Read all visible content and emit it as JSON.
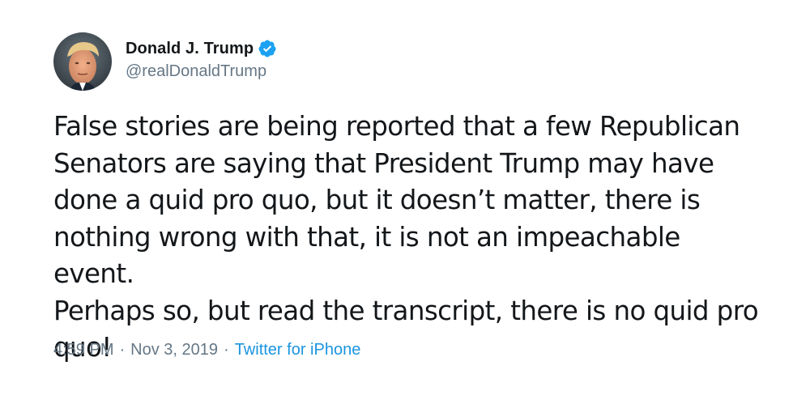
{
  "user": {
    "display_name": "Donald J. Trump",
    "handle": "@realDonaldTrump",
    "verified_icon": "verified-badge-icon"
  },
  "tweet": {
    "text": "False stories are being reported that a few Republican\nSenators are saying that President Trump may have\ndone a quid pro quo, but it doesn’t matter, there is\nnothing wrong with that, it is not an impeachable event.\nPerhaps so, but read the transcript, there is no quid pro\nquo!",
    "time": "4:59 PM",
    "separator": "·",
    "date": "Nov 3, 2019",
    "source": "Twitter for iPhone"
  },
  "colors": {
    "text": "#14171a",
    "muted": "#657786",
    "link": "#1b95e0",
    "verified": "#1da1f2"
  }
}
